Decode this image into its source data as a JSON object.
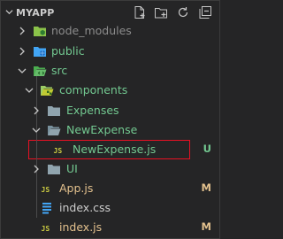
{
  "explorer": {
    "title": "MYAPP",
    "actions": [
      {
        "name": "new-file-icon"
      },
      {
        "name": "new-folder-icon"
      },
      {
        "name": "refresh-icon"
      },
      {
        "name": "collapse-all-icon"
      }
    ]
  },
  "colors": {
    "modified": "#e2c08d",
    "untracked": "#73c991",
    "ignored": "#8c8c8c",
    "selection_border": "#e81123"
  },
  "tree": [
    {
      "label": "node_modules",
      "type": "folder",
      "state": "collapsed",
      "color_role": "ignored"
    },
    {
      "label": "public",
      "type": "folder",
      "state": "collapsed",
      "color_role": "untracked"
    },
    {
      "label": "src",
      "type": "folder",
      "state": "expanded",
      "color_role": "untracked"
    },
    {
      "label": "components",
      "type": "folder",
      "state": "expanded",
      "color_role": "untracked"
    },
    {
      "label": "Expenses",
      "type": "folder",
      "state": "collapsed",
      "color_role": "untracked"
    },
    {
      "label": "NewExpense",
      "type": "folder",
      "state": "expanded",
      "color_role": "untracked"
    },
    {
      "label": "NewExpense.js",
      "type": "file",
      "icon": "js-file-icon",
      "badge": "U",
      "selected": true
    },
    {
      "label": "UI",
      "type": "folder",
      "state": "collapsed",
      "color_role": "untracked"
    },
    {
      "label": "App.js",
      "type": "file",
      "icon": "js-file-icon",
      "badge": "M"
    },
    {
      "label": "index.css",
      "type": "file",
      "icon": "css-file-icon"
    },
    {
      "label": "index.js",
      "type": "file",
      "icon": "js-file-icon",
      "badge": "M"
    }
  ]
}
